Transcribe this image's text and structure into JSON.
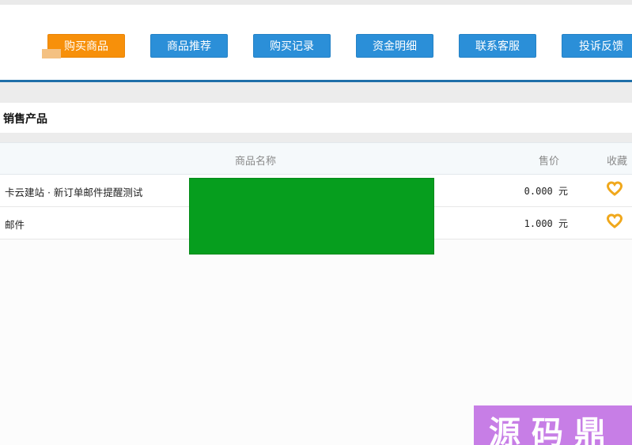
{
  "nav": {
    "buttons": [
      {
        "label": "购买商品",
        "active": true
      },
      {
        "label": "商品推荐",
        "active": false
      },
      {
        "label": "购买记录",
        "active": false
      },
      {
        "label": "资金明细",
        "active": false
      },
      {
        "label": "联系客服",
        "active": false
      },
      {
        "label": "投诉反馈",
        "active": false
      }
    ]
  },
  "section": {
    "title": "销售产品"
  },
  "table": {
    "headers": {
      "name": "商品名称",
      "price": "售价",
      "favorite": "收藏"
    },
    "rows": [
      {
        "name": "卡云建站 · 新订单邮件提醒测试",
        "price": "0.000 元",
        "favorite_icon": "heart-icon"
      },
      {
        "name": "邮件",
        "price": "1.000 元",
        "favorite_icon": "heart-icon"
      }
    ]
  },
  "colors": {
    "accent_blue": "#2b8fd8",
    "active_orange": "#f7900a",
    "nav_underline": "#1f6fa9",
    "heart": "#f0a81c",
    "overlay_green": "#069e1e",
    "watermark": "#c77ee6"
  },
  "watermark": {
    "text": "源码鼎"
  }
}
